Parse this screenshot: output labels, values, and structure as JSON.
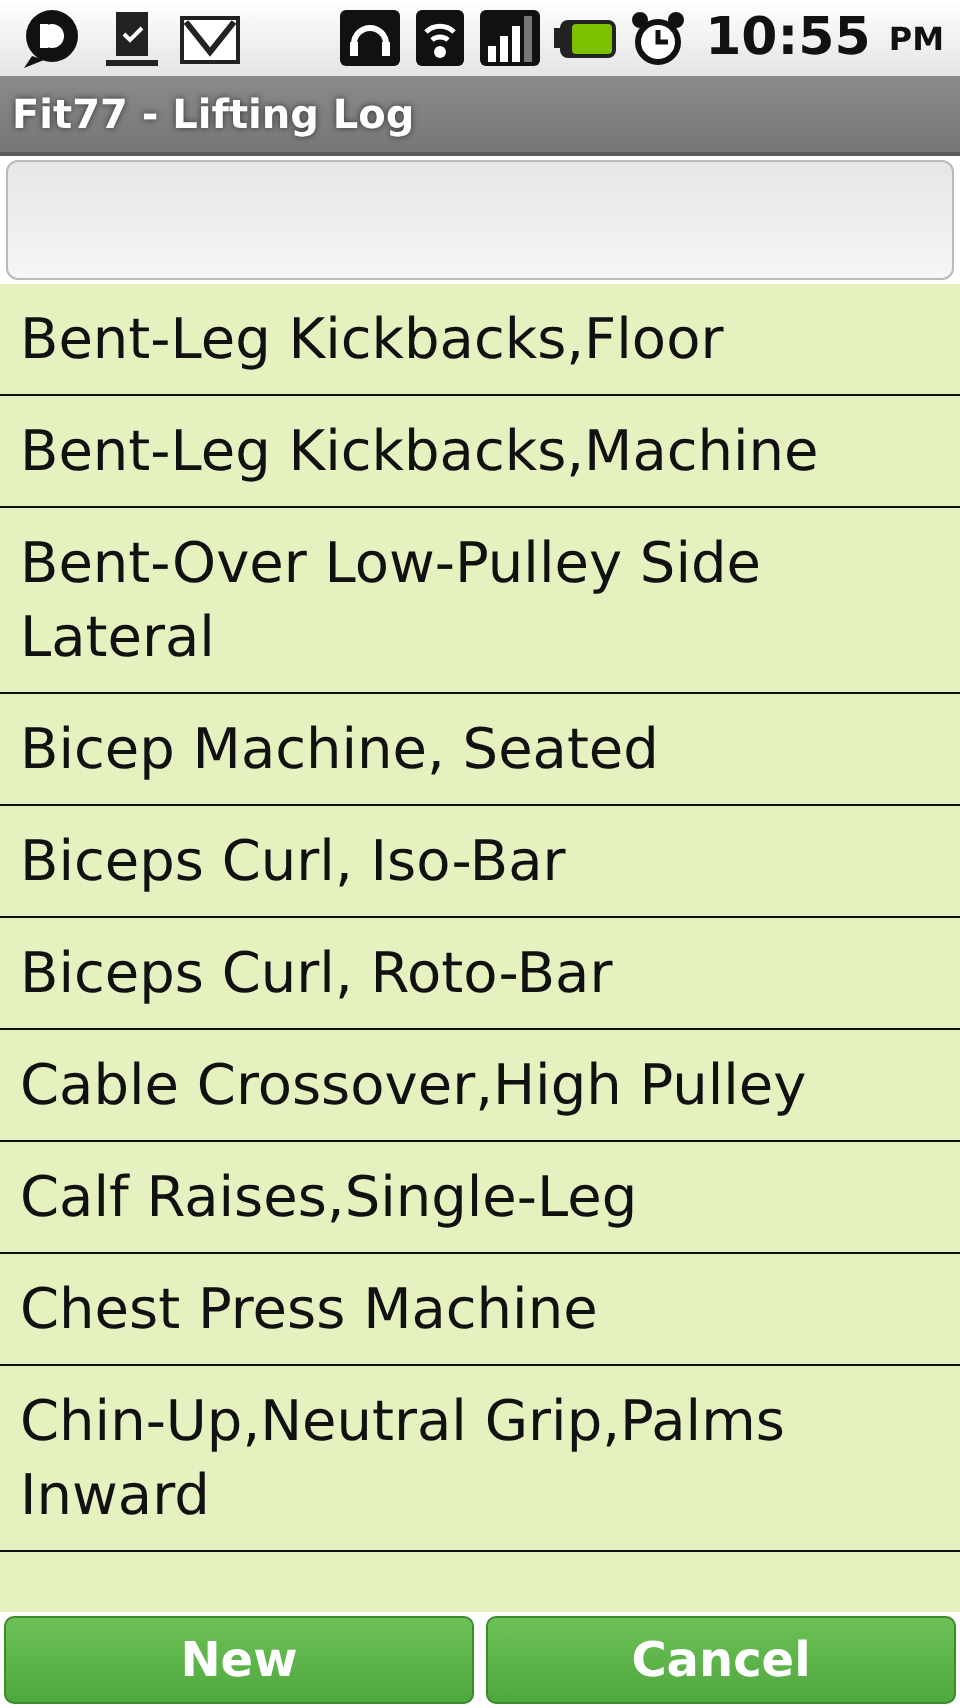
{
  "status_bar": {
    "time": "10:55",
    "ampm": "PM"
  },
  "title_bar": {
    "title": "Fit77 - Lifting Log"
  },
  "exercises": [
    {
      "name": "Bent-Leg Kickbacks,Floor"
    },
    {
      "name": "Bent-Leg Kickbacks,Machine"
    },
    {
      "name": "Bent-Over Low-Pulley Side Lateral"
    },
    {
      "name": "Bicep Machine, Seated"
    },
    {
      "name": "Biceps Curl, Iso-Bar"
    },
    {
      "name": "Biceps Curl, Roto-Bar"
    },
    {
      "name": "Cable Crossover,High Pulley"
    },
    {
      "name": "Calf Raises,Single-Leg"
    },
    {
      "name": "Chest Press Machine"
    },
    {
      "name": "Chin-Up,Neutral Grip,Palms Inward"
    }
  ],
  "buttons": [
    {
      "label": "New"
    },
    {
      "label": "Cancel"
    }
  ]
}
